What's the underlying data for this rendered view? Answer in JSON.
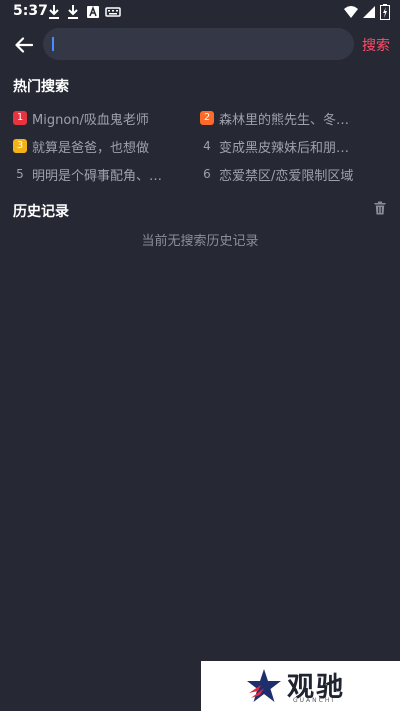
{
  "status_bar": {
    "time": "5:37",
    "left_icons": [
      "download-icon",
      "download-icon",
      "text-a-icon",
      "keyboard-icon"
    ],
    "right_icons": [
      "wifi-icon",
      "signal-icon",
      "battery-icon"
    ]
  },
  "search": {
    "input_value": "",
    "button_label": "搜索",
    "accent_color": "#ff4d6a"
  },
  "hot_search": {
    "title": "热门搜索",
    "items": [
      {
        "rank": "1",
        "text": "Mignon/吸血鬼老师",
        "badge_color": "#e8343f"
      },
      {
        "rank": "2",
        "text": "森林里的熊先生、冬…",
        "badge_color": "#ff6a2b"
      },
      {
        "rank": "3",
        "text": "就算是爸爸，也想做",
        "badge_color": "#f2b21a"
      },
      {
        "rank": "4",
        "text": "变成黑皮辣妹后和朋…",
        "badge_color": ""
      },
      {
        "rank": "5",
        "text": "明明是个碍事配角、…",
        "badge_color": ""
      },
      {
        "rank": "6",
        "text": "恋爱禁区/恋爱限制区域",
        "badge_color": ""
      }
    ]
  },
  "history": {
    "title": "历史记录",
    "empty_text": "当前无搜索历史记录"
  },
  "watermark": {
    "text": "观驰",
    "subtext": "GUANCHI"
  }
}
